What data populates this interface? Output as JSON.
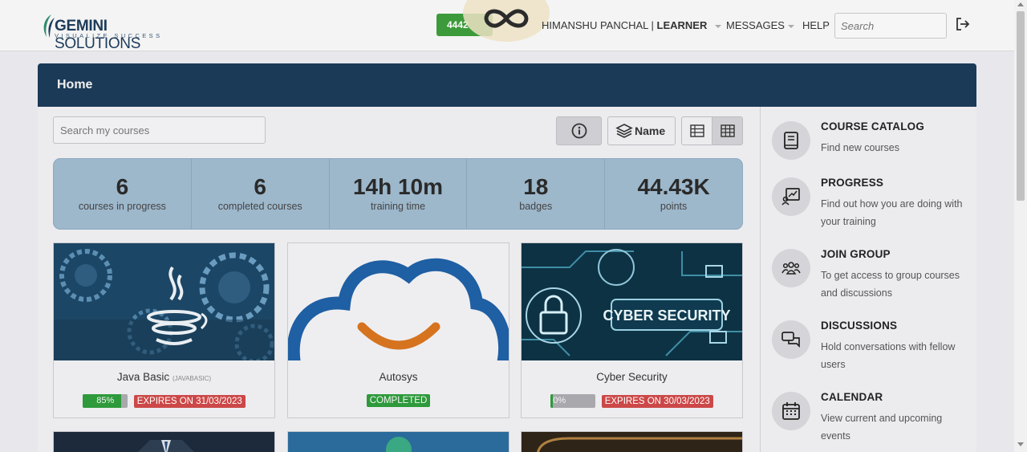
{
  "brand": {
    "name_bold": "GEMINI",
    "name_rest": " SOLUTIONS",
    "tagline": "VISUALIZE SUCCESS"
  },
  "topbar": {
    "points_label": "4442",
    "user_name": "HIMANSHU PANCHAL | ",
    "user_role": "LEARNER",
    "messages_label": "MESSAGES",
    "help_label": "HELP",
    "search_placeholder": "Search"
  },
  "page": {
    "title": "Home",
    "course_search_placeholder": "Search my courses",
    "sort_label": "Name"
  },
  "stats": [
    {
      "value": "6",
      "label": "courses in progress"
    },
    {
      "value": "6",
      "label": "completed courses"
    },
    {
      "value": "14h 10m",
      "label": "training time"
    },
    {
      "value": "18",
      "label": "badges"
    },
    {
      "value": "44.43K",
      "label": "points"
    }
  ],
  "courses": [
    {
      "title": "Java Basic",
      "code": "(JAVABASIC)",
      "progress_text": "85%",
      "progress": 0.85,
      "expires": "EXPIRES ON 31/03/2023"
    },
    {
      "title": "Autosys",
      "status": "COMPLETED"
    },
    {
      "title": "Cyber Security",
      "progress_text": "0%",
      "progress": 0.0,
      "expires": "EXPIRES ON 30/03/2023",
      "image_text": "CYBER SECURITY"
    }
  ],
  "sidebar": [
    {
      "title": "COURSE CATALOG",
      "desc": "Find new courses",
      "icon": "book-icon"
    },
    {
      "title": "PROGRESS",
      "desc": "Find out how you are doing with your training",
      "icon": "progress-chart-icon"
    },
    {
      "title": "JOIN GROUP",
      "desc": "To get access to group courses and discussions",
      "icon": "group-icon"
    },
    {
      "title": "DISCUSSIONS",
      "desc": "Hold conversations with fellow users",
      "icon": "chat-icon"
    },
    {
      "title": "CALENDAR",
      "desc": "View current and upcoming events",
      "icon": "calendar-icon"
    }
  ],
  "colors": {
    "header": "#1b3a57",
    "green": "#2e9a3b",
    "red": "#cc4848",
    "stats_bg": "#9db7cb"
  }
}
